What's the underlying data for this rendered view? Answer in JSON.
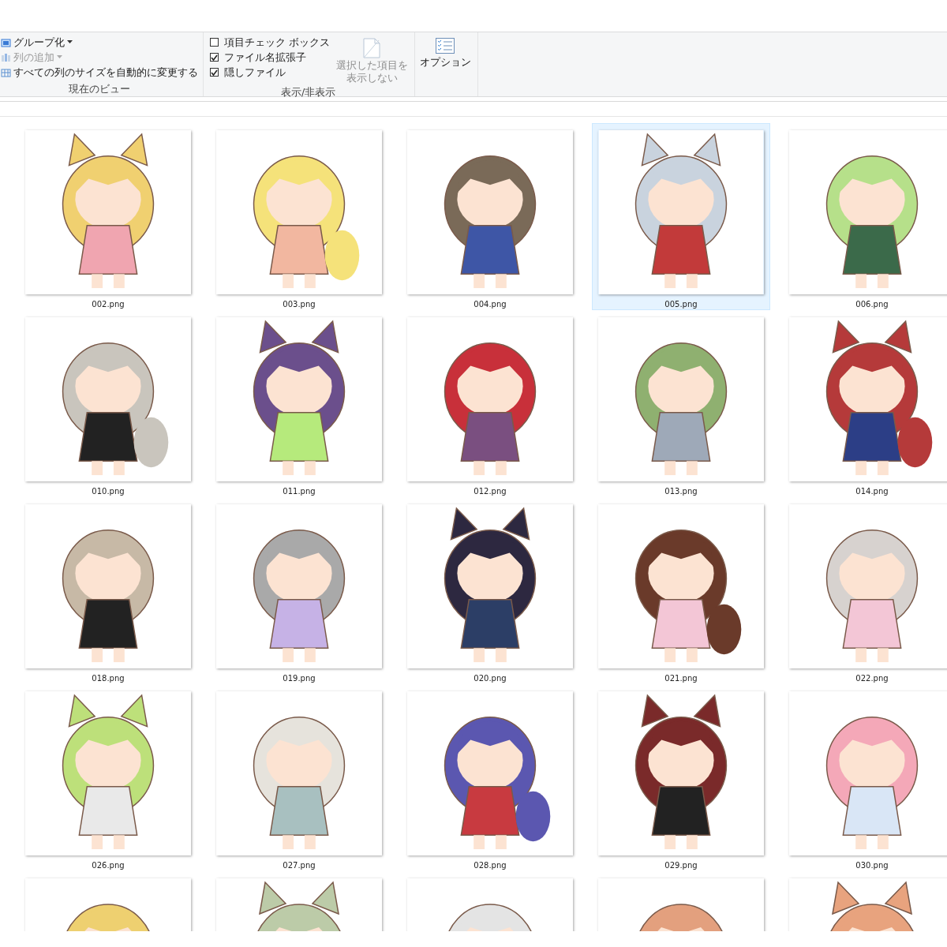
{
  "ribbon": {
    "groups": [
      {
        "kind": "view",
        "caption": "現在のビュー",
        "items": [
          {
            "label": "グループ化",
            "disabled": false,
            "dropdown": true
          },
          {
            "label": "列の追加",
            "disabled": true,
            "dropdown": true
          },
          {
            "label": "すべての列のサイズを自動的に変更する",
            "disabled": false,
            "dropdown": false
          }
        ]
      },
      {
        "kind": "show",
        "caption": "表示/非表示",
        "checks": [
          {
            "label": "項目チェック ボックス",
            "checked": false
          },
          {
            "label": "ファイル名拡張子",
            "checked": true
          },
          {
            "label": "隠しファイル",
            "checked": true
          }
        ],
        "hide_button": {
          "lines": [
            "選択した項目を",
            "表示しない"
          ],
          "disabled": true
        }
      },
      {
        "kind": "options",
        "button": {
          "label": "オプション"
        }
      }
    ]
  },
  "files": [
    {
      "name": "002.png",
      "selected": false
    },
    {
      "name": "003.png",
      "selected": false
    },
    {
      "name": "004.png",
      "selected": false
    },
    {
      "name": "005.png",
      "selected": true
    },
    {
      "name": "006.png",
      "selected": false
    },
    {
      "name": "010.png",
      "selected": false
    },
    {
      "name": "011.png",
      "selected": false
    },
    {
      "name": "012.png",
      "selected": false
    },
    {
      "name": "013.png",
      "selected": false
    },
    {
      "name": "014.png",
      "selected": false
    },
    {
      "name": "018.png",
      "selected": false
    },
    {
      "name": "019.png",
      "selected": false
    },
    {
      "name": "020.png",
      "selected": false
    },
    {
      "name": "021.png",
      "selected": false
    },
    {
      "name": "022.png",
      "selected": false
    },
    {
      "name": "026.png",
      "selected": false
    },
    {
      "name": "027.png",
      "selected": false
    },
    {
      "name": "028.png",
      "selected": false
    },
    {
      "name": "029.png",
      "selected": false
    },
    {
      "name": "030.png",
      "selected": false
    },
    {
      "selected": false
    },
    {
      "selected": false
    },
    {
      "selected": false
    },
    {
      "selected": false
    },
    {
      "selected": false
    }
  ]
}
